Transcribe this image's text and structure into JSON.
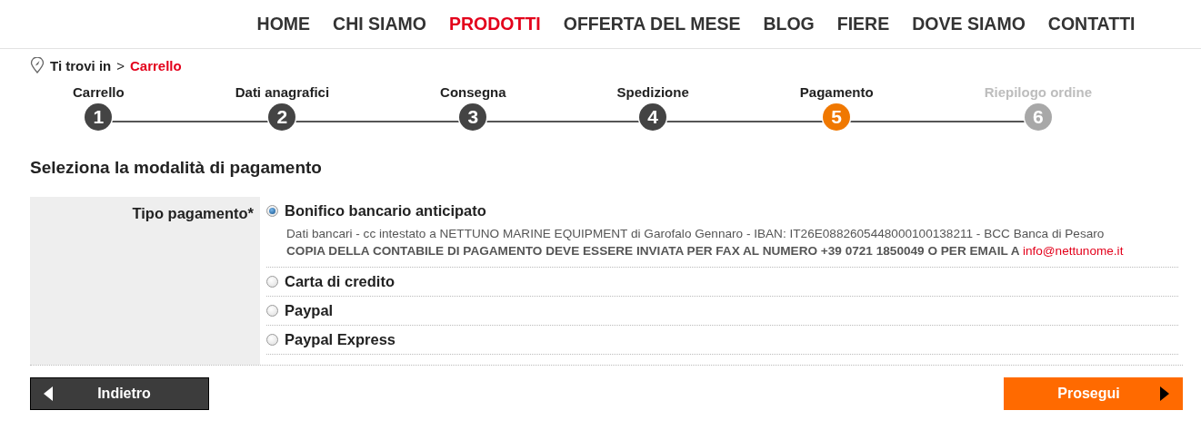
{
  "nav": [
    {
      "label": "HOME",
      "selected": false
    },
    {
      "label": "CHI SIAMO",
      "selected": false
    },
    {
      "label": "PRODOTTI",
      "selected": true
    },
    {
      "label": "OFFERTA DEL MESE",
      "selected": false
    },
    {
      "label": "BLOG",
      "selected": false
    },
    {
      "label": "FIERE",
      "selected": false
    },
    {
      "label": "DOVE SIAMO",
      "selected": false
    },
    {
      "label": "CONTATTI",
      "selected": false
    }
  ],
  "breadcrumb": {
    "prefix": "Ti trovi in",
    "separator": ">",
    "current": "Carrello"
  },
  "steps": [
    {
      "label": "Carrello",
      "number": "1",
      "completed": true,
      "selected": false
    },
    {
      "label": "Dati anagrafici",
      "number": "2",
      "completed": true,
      "selected": false
    },
    {
      "label": "Consegna",
      "number": "3",
      "completed": true,
      "selected": false
    },
    {
      "label": "Spedizione",
      "number": "4",
      "completed": true,
      "selected": false
    },
    {
      "label": "Pagamento",
      "number": "5",
      "completed": false,
      "selected": true
    },
    {
      "label": "Riepilogo ordine",
      "number": "6",
      "completed": false,
      "selected": false
    }
  ],
  "heading": "Seleziona la modalità di pagamento",
  "payment": {
    "label": "Tipo pagamento*",
    "options": [
      {
        "label": "Bonifico bancario anticipato",
        "selected": true,
        "details": [
          {
            "kind": "plain",
            "text": "Dati bancari - cc intestato a NETTUNO MARINE EQUIPMENT di Garofalo Gennaro - IBAN: IT26E0882605448000100138211 - BCC Banca di Pesaro"
          },
          {
            "kind": "notice",
            "text": "COPIA DELLA CONTABILE DI PAGAMENTO DEVE ESSERE INVIATA PER FAX AL NUMERO +39 0721 1850049 O PER EMAIL A",
            "link": "info@nettunome.it"
          }
        ]
      },
      {
        "label": "Carta di credito",
        "selected": false
      },
      {
        "label": "Paypal",
        "selected": false
      },
      {
        "label": "Paypal Express",
        "selected": false
      }
    ]
  },
  "buttons": [
    {
      "kind": "back",
      "label": "Indietro"
    },
    {
      "kind": "next",
      "label": "Prosegui"
    }
  ]
}
